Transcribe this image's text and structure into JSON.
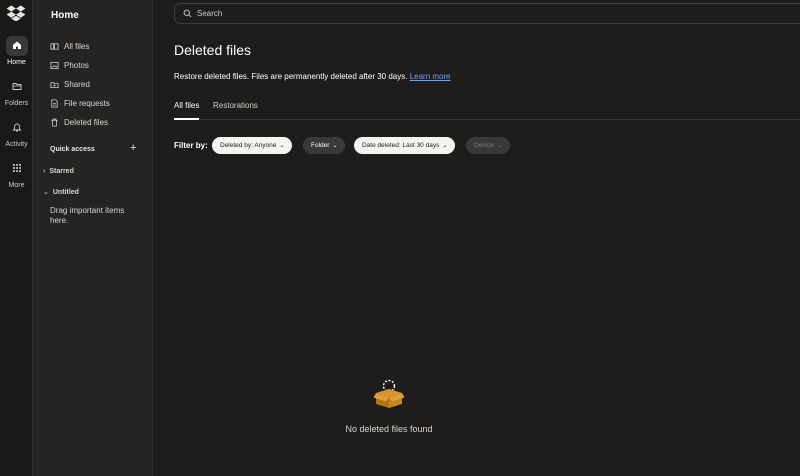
{
  "rail": {
    "items": [
      {
        "label": "Home",
        "icon": "home-icon",
        "active": true
      },
      {
        "label": "Folders",
        "icon": "folder-icon",
        "active": false
      },
      {
        "label": "Activity",
        "icon": "bell-icon",
        "active": false
      },
      {
        "label": "More",
        "icon": "grid-icon",
        "active": false
      }
    ]
  },
  "sidebar": {
    "title": "Home",
    "items": [
      {
        "label": "All files",
        "icon": "files-icon"
      },
      {
        "label": "Photos",
        "icon": "photo-icon"
      },
      {
        "label": "Shared",
        "icon": "shared-icon"
      },
      {
        "label": "File requests",
        "icon": "file-request-icon"
      },
      {
        "label": "Deleted files",
        "icon": "trash-icon"
      }
    ],
    "quick_access": "Quick access",
    "add": "+",
    "tree": [
      {
        "label": "Starred",
        "chevron": "›"
      },
      {
        "label": "Untitled",
        "chevron": "⌄"
      }
    ],
    "hint": "Drag important items here."
  },
  "search": {
    "placeholder": "Search"
  },
  "main": {
    "title": "Deleted files",
    "description": "Restore deleted files. Files are permanently deleted after 30 days.",
    "learn_more": "Learn more",
    "tabs": [
      {
        "label": "All files",
        "active": true
      },
      {
        "label": "Restorations",
        "active": false
      }
    ],
    "filter_label": "Filter by:",
    "filters": [
      {
        "label": "Deleted by: Anyone",
        "style": "light"
      },
      {
        "label": "Folder",
        "style": "dark"
      },
      {
        "label": "Date deleted: Last 30 days",
        "style": "light"
      },
      {
        "label": "Device",
        "style": "disabled"
      }
    ],
    "empty_text": "No deleted files found"
  },
  "colors": {
    "accent_link": "#6aa3ff",
    "empty_icon": "#c8861a"
  }
}
